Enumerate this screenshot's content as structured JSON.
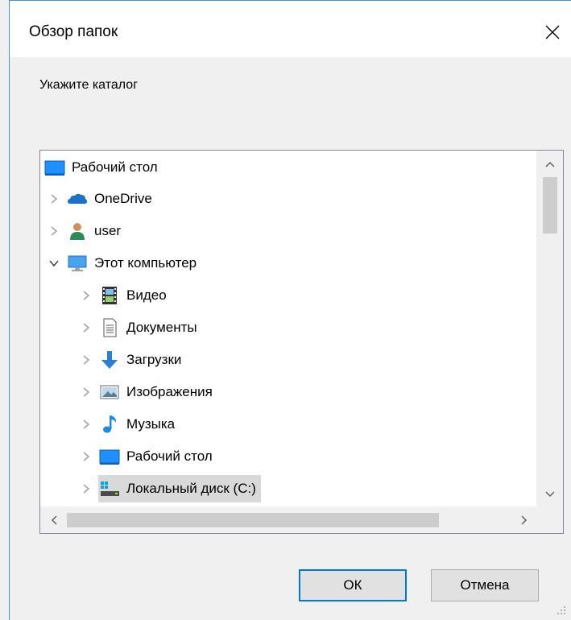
{
  "dialog": {
    "title": "Обзор папок",
    "prompt": "Укажите каталог",
    "ok_label": "ОК",
    "cancel_label": "Отмена"
  },
  "tree": {
    "items": [
      {
        "label": "Рабочий стол",
        "icon": "desktop-icon",
        "expander": "none",
        "level": 0
      },
      {
        "label": "OneDrive",
        "icon": "onedrive-cloud-icon",
        "expander": "collapsed",
        "level": 1
      },
      {
        "label": "user",
        "icon": "user-folder-icon",
        "expander": "collapsed",
        "level": 1
      },
      {
        "label": "Этот компьютер",
        "icon": "this-pc-icon",
        "expander": "expanded",
        "level": 1
      },
      {
        "label": "Видео",
        "icon": "videos-icon",
        "expander": "collapsed",
        "level": 2
      },
      {
        "label": "Документы",
        "icon": "documents-icon",
        "expander": "collapsed",
        "level": 2
      },
      {
        "label": "Загрузки",
        "icon": "downloads-icon",
        "expander": "collapsed",
        "level": 2
      },
      {
        "label": "Изображения",
        "icon": "pictures-icon",
        "expander": "collapsed",
        "level": 2
      },
      {
        "label": "Музыка",
        "icon": "music-icon",
        "expander": "collapsed",
        "level": 2
      },
      {
        "label": "Рабочий стол",
        "icon": "desktop-icon",
        "expander": "collapsed",
        "level": 2
      },
      {
        "label": "Локальный диск (C:)",
        "icon": "local-disk-icon",
        "expander": "collapsed",
        "level": 2,
        "selected": true
      }
    ]
  },
  "colors": {
    "accent": "#0078d7",
    "selection": "#d9d9d9",
    "window_border": "#4a90d6"
  }
}
